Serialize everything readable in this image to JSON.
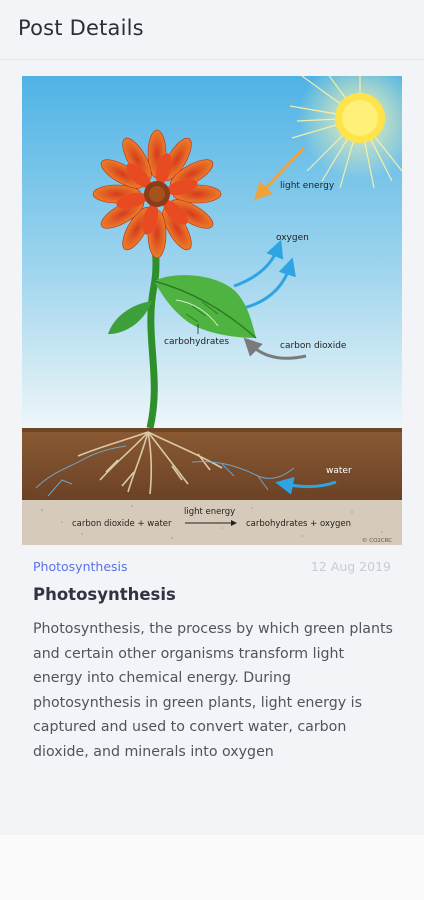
{
  "header": {
    "title": "Post Details"
  },
  "image": {
    "labels": {
      "light_energy": "light energy",
      "oxygen": "oxygen",
      "carbon_dioxide": "carbon dioxide",
      "carbohydrates": "carbohydrates",
      "water": "water",
      "equation_light": "light energy",
      "equation_left": "carbon dioxide + water",
      "equation_right": "carbohydrates + oxygen",
      "credit": "© CO2CRC"
    },
    "colors": {
      "sky_top": "#53b6e6",
      "sky_bottom": "#e7f3f8",
      "soil": "#7b4e2c",
      "sun": "#ffe34a",
      "arrow_blue": "#2fa4e3",
      "arrow_orange": "#f0a33a",
      "arrow_grey": "#7a7a7a"
    }
  },
  "post": {
    "category": "Photosynthesis",
    "date": "12 Aug 2019",
    "title": "Photosynthesis",
    "body": "Photosynthesis, the process by which green plants and certain other organisms transform light energy into chemical energy. During photosynthesis in green plants, light energy is captured and used to convert water, carbon dioxide, and minerals into oxygen"
  }
}
